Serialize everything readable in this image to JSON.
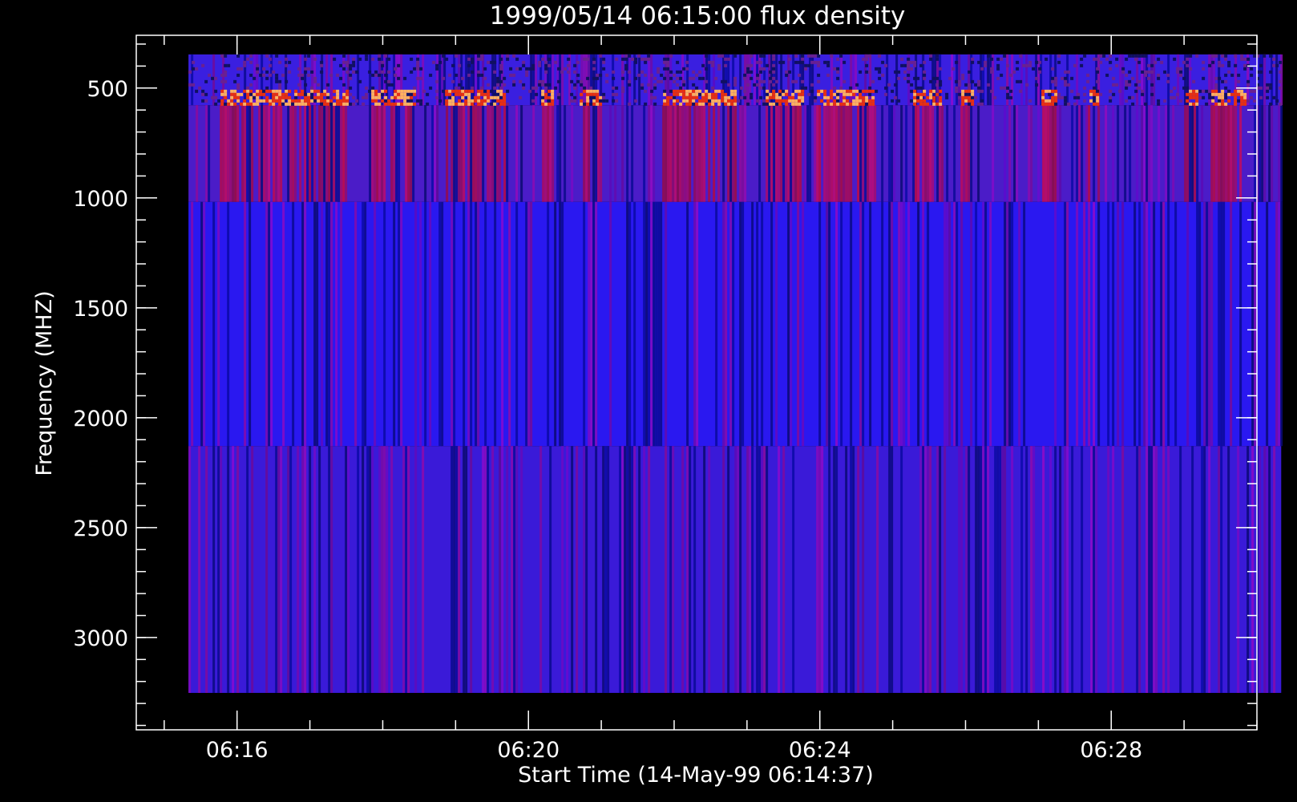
{
  "chart_data": {
    "type": "heatmap",
    "title": "1999/05/14 06:15:00 flux density",
    "xlabel": "Start Time (14-May-99 06:14:37)",
    "ylabel": "Frequency (MHZ)",
    "xlim": [
      "06:14:37",
      "06:30:00"
    ],
    "ylim": [
      3420,
      260
    ],
    "x_ticks": [
      {
        "value": "06:16",
        "label": "06:16"
      },
      {
        "value": "06:20",
        "label": "06:20"
      },
      {
        "value": "06:24",
        "label": "06:24"
      },
      {
        "value": "06:28",
        "label": "06:28"
      }
    ],
    "y_ticks": [
      {
        "value": 500,
        "label": "500"
      },
      {
        "value": 1000,
        "label": "1000"
      },
      {
        "value": 1500,
        "label": "1500"
      },
      {
        "value": 2000,
        "label": "2000"
      },
      {
        "value": 2500,
        "label": "2500"
      },
      {
        "value": 3000,
        "label": "3000"
      }
    ],
    "data_extent": {
      "time_start": "06:15:20",
      "time_end": "06:30:20",
      "freq_min": 347,
      "freq_max": 3252
    },
    "bands": [
      {
        "freq_range": [
          347,
          578
        ],
        "description_color": "#3a1fe0",
        "activity": "high"
      },
      {
        "freq_range": [
          578,
          1018
        ],
        "description_color": "#4b1cc8",
        "activity": "medium"
      },
      {
        "freq_range": [
          1018,
          2129
        ],
        "description_color": "#2a18f0",
        "activity": "low"
      },
      {
        "freq_range": [
          2129,
          3252
        ],
        "description_color": "#3a1ad8",
        "activity": "low"
      }
    ],
    "bursts": [
      {
        "start": "06:15:45",
        "end": "06:17:30"
      },
      {
        "start": "06:17:50",
        "end": "06:18:25"
      },
      {
        "start": "06:18:50",
        "end": "06:19:40"
      },
      {
        "start": "06:20:10",
        "end": "06:20:20"
      },
      {
        "start": "06:20:40",
        "end": "06:21:00"
      },
      {
        "start": "06:21:50",
        "end": "06:22:50"
      },
      {
        "start": "06:23:15",
        "end": "06:23:45"
      },
      {
        "start": "06:23:55",
        "end": "06:24:45"
      },
      {
        "start": "06:25:15",
        "end": "06:25:40"
      },
      {
        "start": "06:25:55",
        "end": "06:26:05"
      },
      {
        "start": "06:27:00",
        "end": "06:27:15"
      },
      {
        "start": "06:27:40",
        "end": "06:27:50"
      },
      {
        "start": "06:29:00",
        "end": "06:29:10"
      },
      {
        "start": "06:29:20",
        "end": "06:29:50"
      }
    ],
    "colors": {
      "background": "#000000",
      "axes": "#ffffff",
      "low": "#1010ff",
      "mid": "#9010b0",
      "high": "#ff5020"
    },
    "grid": false,
    "legend": "none"
  }
}
